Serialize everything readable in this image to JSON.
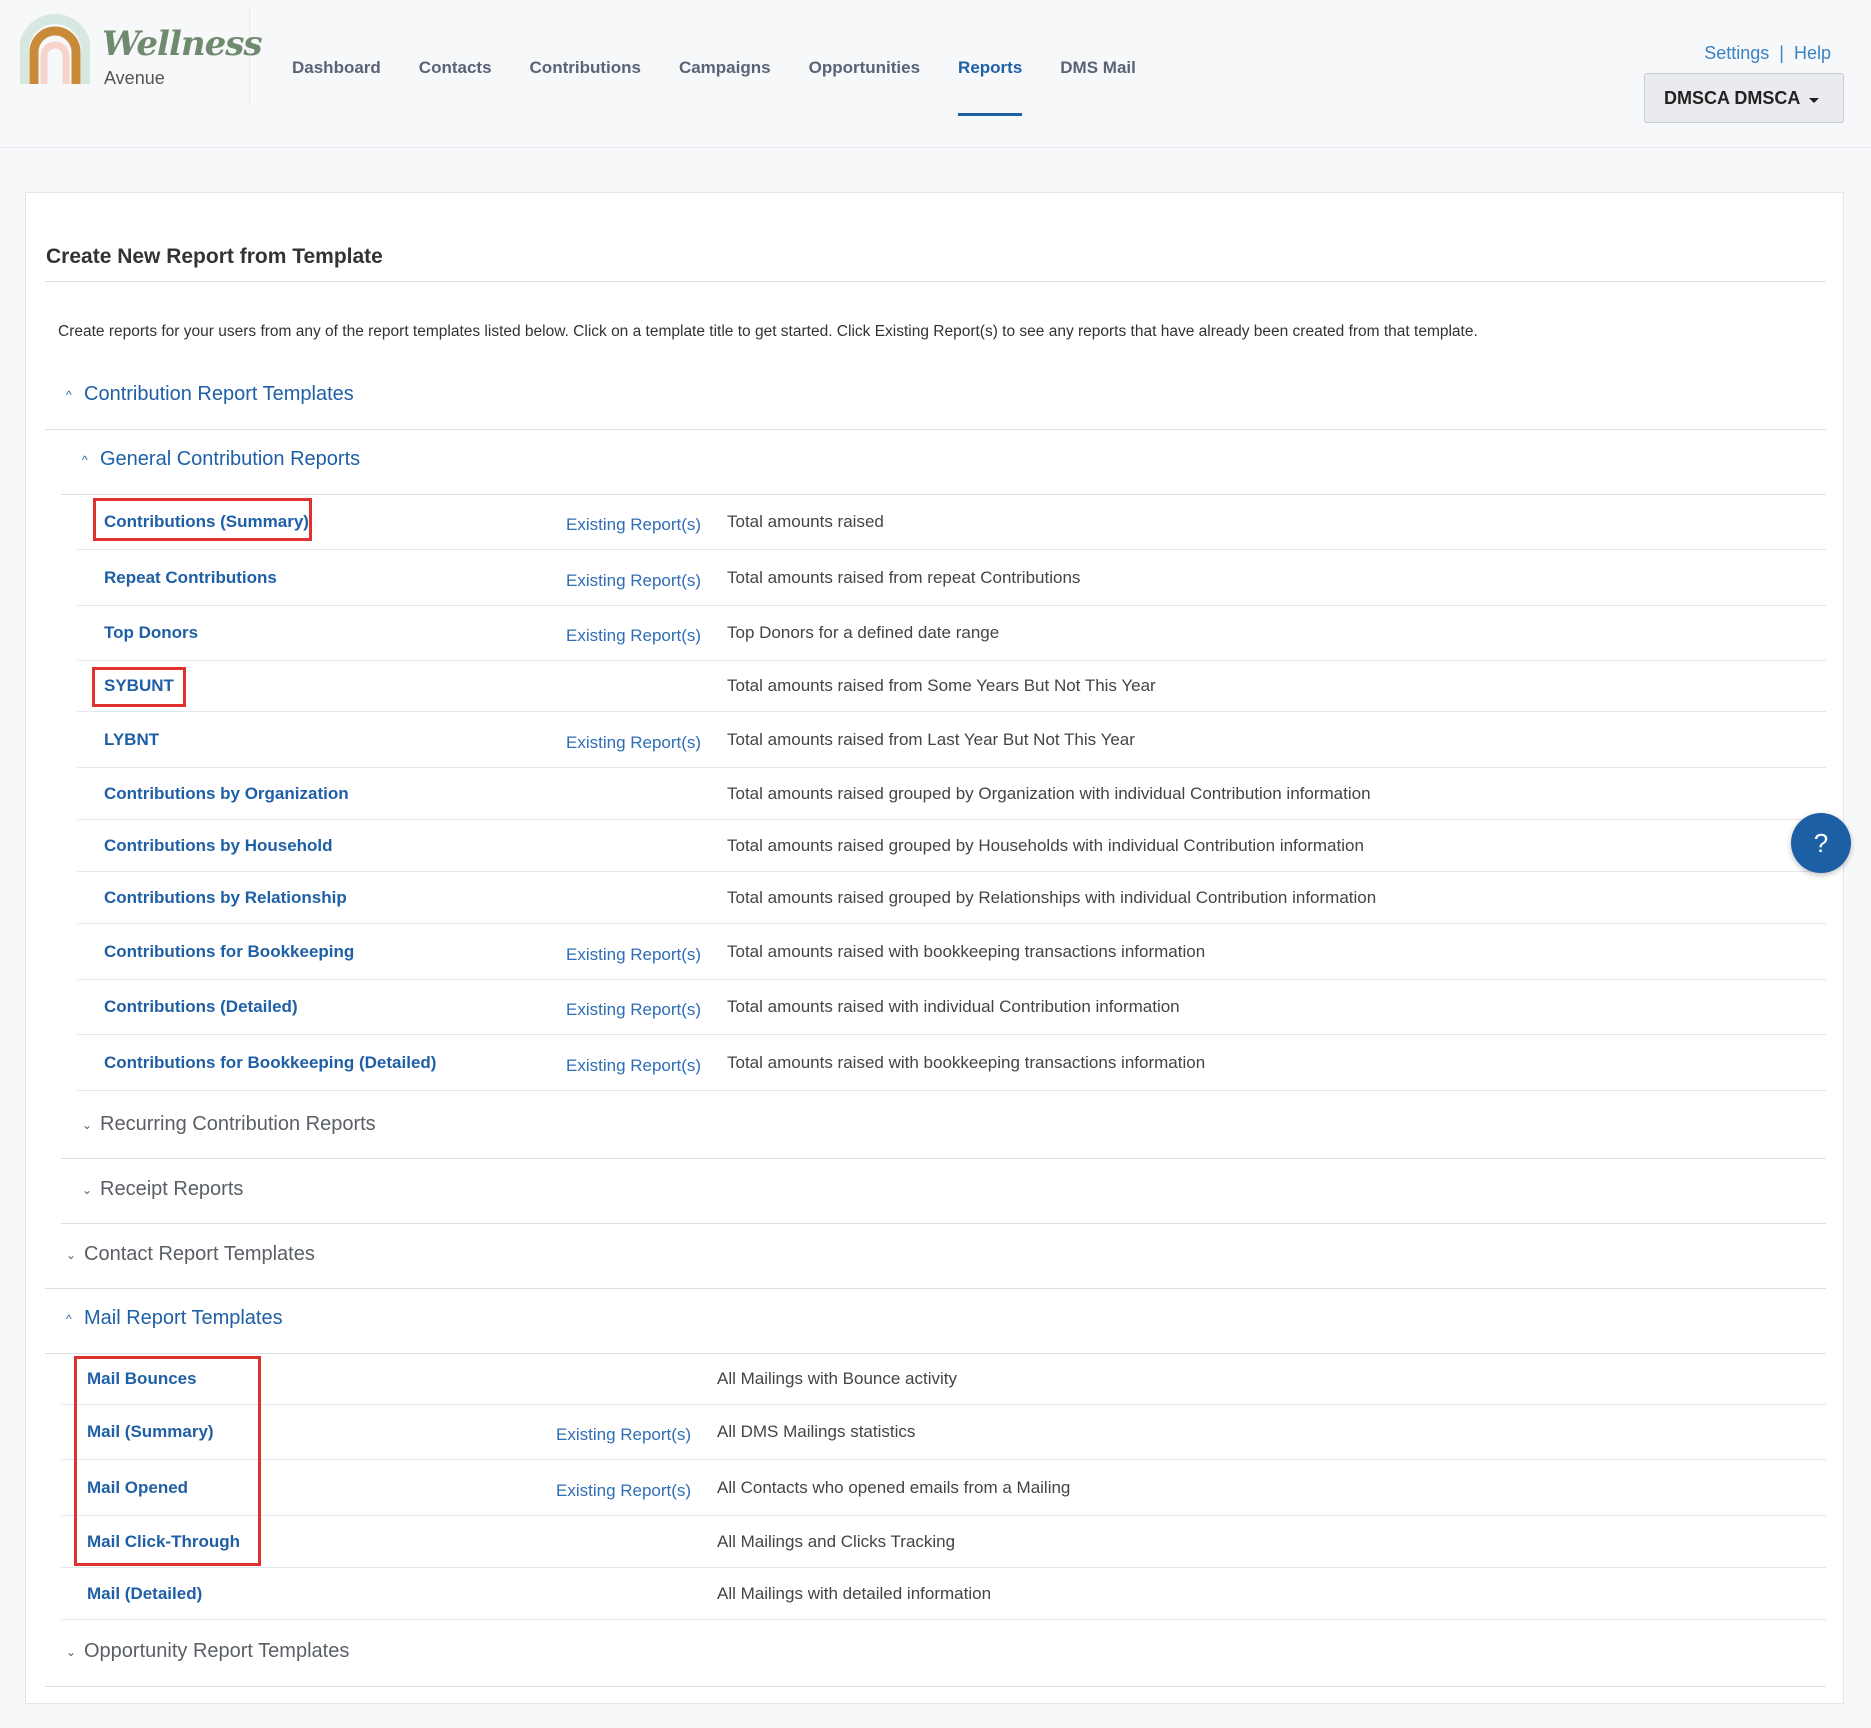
{
  "logo": {
    "word": "Wellness",
    "sub": "Avenue"
  },
  "nav": [
    "Dashboard",
    "Contacts",
    "Contributions",
    "Campaigns",
    "Opportunities",
    "Reports",
    "DMS Mail"
  ],
  "nav_active": "Reports",
  "top_links": {
    "settings": "Settings",
    "separator": "|",
    "help": "Help"
  },
  "user_menu": "DMSCA DMSCA",
  "page": {
    "title": "Create New Report from Template",
    "description": "Create reports for your users from any of the report templates listed below. Click on a template title to get started. Click Existing Report(s) to see any reports that have already been created from that template."
  },
  "sections": {
    "contribution": "Contribution Report Templates",
    "general": "General Contribution Reports",
    "recurring": "Recurring Contribution Reports",
    "receipt": "Receipt Reports",
    "contact": "Contact Report Templates",
    "mail": "Mail Report Templates",
    "opportunity": "Opportunity Report Templates"
  },
  "existing_label": "Existing Report(s)",
  "general_rows": [
    {
      "name": "Contributions (Summary)",
      "existing": true,
      "desc": "Total amounts raised"
    },
    {
      "name": "Repeat Contributions",
      "existing": true,
      "desc": "Total amounts raised from repeat Contributions"
    },
    {
      "name": "Top Donors",
      "existing": true,
      "desc": "Top Donors for a defined date range"
    },
    {
      "name": "SYBUNT",
      "existing": false,
      "desc": "Total amounts raised from Some Years But Not This Year"
    },
    {
      "name": "LYBNT",
      "existing": true,
      "desc": "Total amounts raised from Last Year But Not This Year"
    },
    {
      "name": "Contributions by Organization",
      "existing": false,
      "desc": "Total amounts raised grouped by Organization with individual Contribution information"
    },
    {
      "name": "Contributions by Household",
      "existing": false,
      "desc": "Total amounts raised grouped by Households with individual Contribution information"
    },
    {
      "name": "Contributions by Relationship",
      "existing": false,
      "desc": "Total amounts raised grouped by Relationships with individual Contribution information"
    },
    {
      "name": "Contributions for Bookkeeping",
      "existing": true,
      "desc": "Total amounts raised with bookkeeping transactions information"
    },
    {
      "name": "Contributions (Detailed)",
      "existing": true,
      "desc": "Total amounts raised with individual Contribution information"
    },
    {
      "name": "Contributions for Bookkeeping (Detailed)",
      "existing": true,
      "desc": "Total amounts raised with bookkeeping transactions information"
    }
  ],
  "mail_rows": [
    {
      "name": "Mail Bounces",
      "existing": false,
      "desc": "All Mailings with Bounce activity"
    },
    {
      "name": "Mail (Summary)",
      "existing": true,
      "desc": "All DMS Mailings statistics"
    },
    {
      "name": "Mail Opened",
      "existing": true,
      "desc": "All Contacts who opened emails from a Mailing"
    },
    {
      "name": "Mail Click-Through",
      "existing": false,
      "desc": "All Mailings and Clicks Tracking"
    },
    {
      "name": "Mail (Detailed)",
      "existing": false,
      "desc": "All Mailings with detailed information"
    }
  ],
  "help_bubble": "?"
}
